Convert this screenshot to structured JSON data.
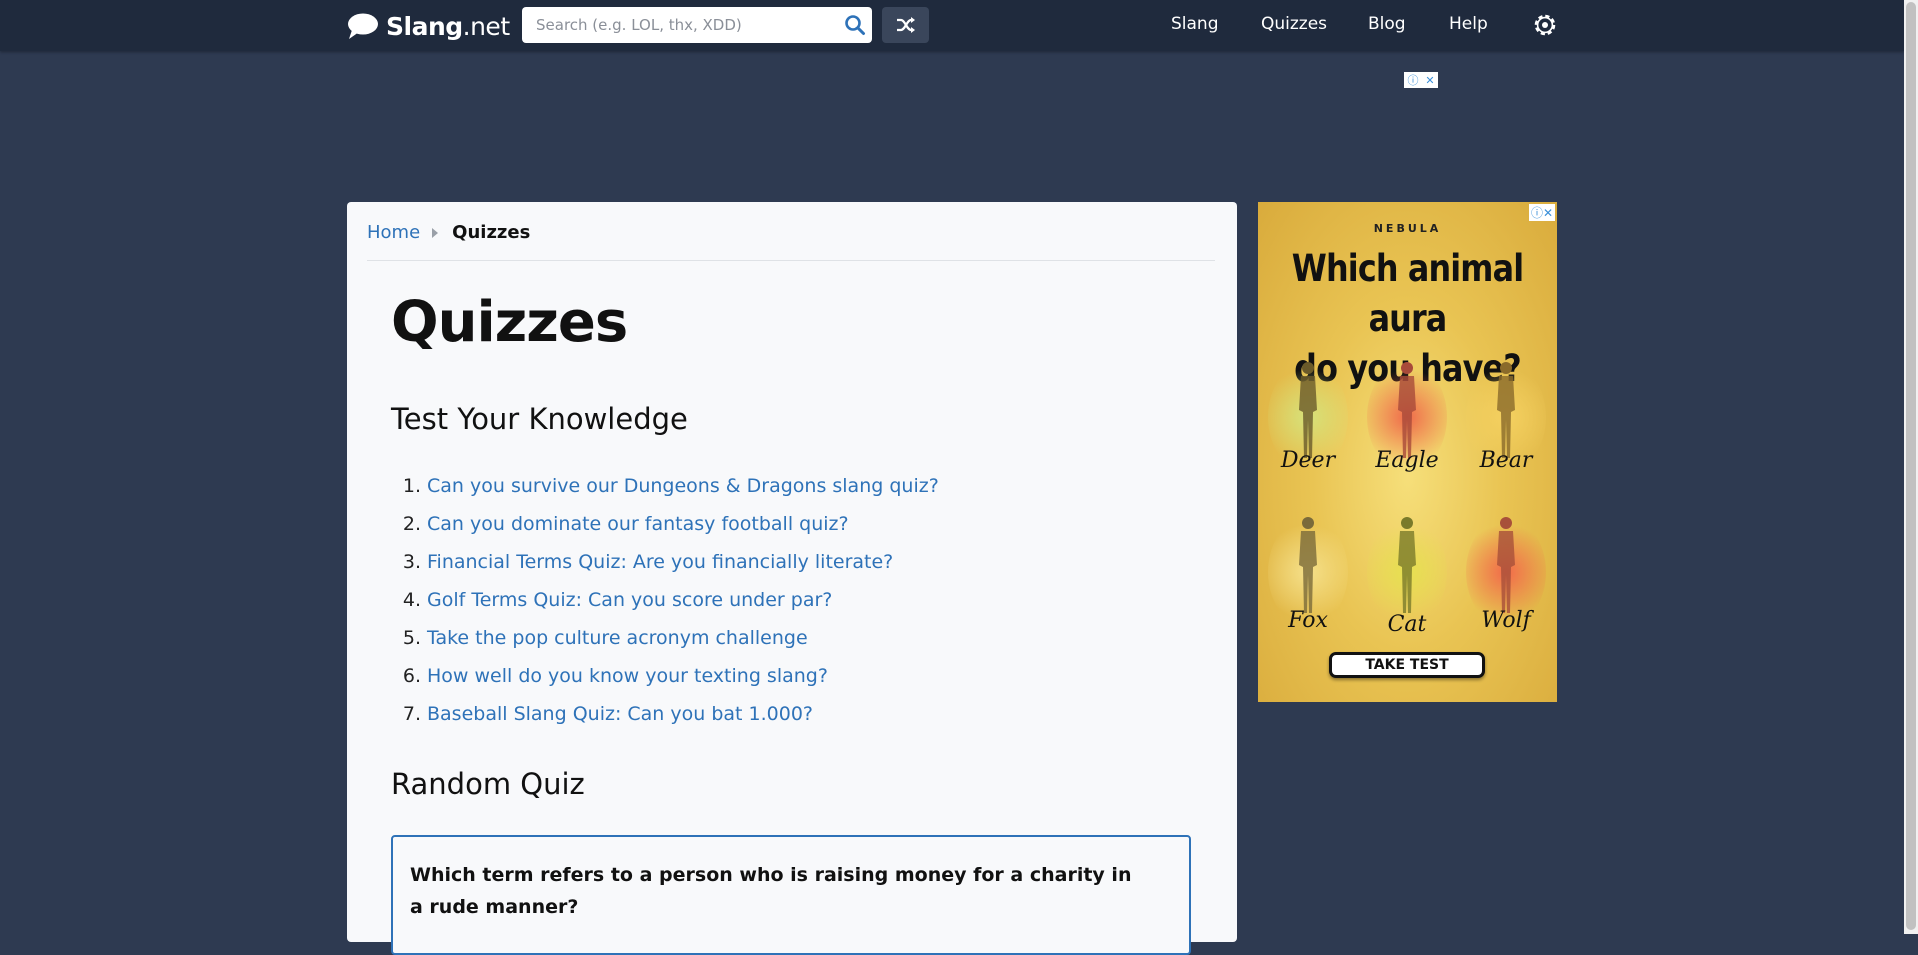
{
  "header": {
    "logo_name": "Slang",
    "logo_tld": ".net",
    "search_placeholder": "Search (e.g. LOL, thx, XDD)",
    "nav": [
      "Slang",
      "Quizzes",
      "Blog",
      "Help"
    ]
  },
  "breadcrumb": {
    "home": "Home",
    "current": "Quizzes"
  },
  "page": {
    "title": "Quizzes",
    "section_test": "Test Your Knowledge",
    "quizzes": [
      {
        "num": "1.",
        "label": "Can you survive our Dungeons & Dragons slang quiz?"
      },
      {
        "num": "2.",
        "label": "Can you dominate our fantasy football quiz?"
      },
      {
        "num": "3.",
        "label": "Financial Terms Quiz: Are you financially literate?"
      },
      {
        "num": "4.",
        "label": "Golf Terms Quiz: Can you score under par?"
      },
      {
        "num": "5.",
        "label": "Take the pop culture acronym challenge"
      },
      {
        "num": "6.",
        "label": "How well do you know your texting slang?"
      },
      {
        "num": "7.",
        "label": "Baseball Slang Quiz: Can you bat 1.000?"
      }
    ],
    "section_random": "Random Quiz",
    "random_question": "Which term refers to a person who is raising money for a charity in a rude manner?"
  },
  "ad": {
    "brand": "NEBULA",
    "headline_1": "Which animal aura",
    "headline_2": "do you have?",
    "animals": [
      "Deer",
      "Eagle",
      "Bear",
      "Fox",
      "Cat",
      "Wolf"
    ],
    "cta": "TAKE TEST"
  },
  "colors": {
    "background": "#2e3a51",
    "header": "#1f2a3d",
    "link": "#2e72b8",
    "card": "#f8f9fb"
  }
}
